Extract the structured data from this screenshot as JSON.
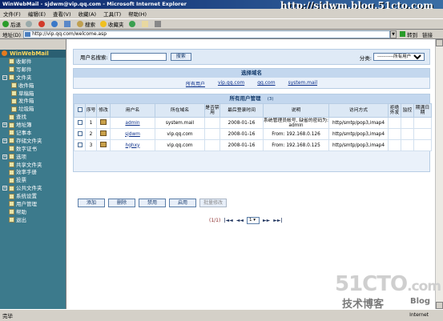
{
  "window": {
    "title": "WinWebMail - sjdwm@vip.qq.com - Microsoft Internet Explorer"
  },
  "watermark": "http://sjdwm.blog.51cto.com",
  "menu": [
    "文件(F)",
    "编辑(E)",
    "查看(V)",
    "收藏(A)",
    "工具(T)",
    "帮助(H)"
  ],
  "toolbar": {
    "back": "后退",
    "search": "搜索",
    "favorites": "收藏夹"
  },
  "address": {
    "label": "地址(D)",
    "url": "http://vip.qq.com/welcome.asp",
    "go": "转到",
    "links": "链接"
  },
  "sidebar": {
    "header": "WinWebMail",
    "items": [
      {
        "label": "收邮件",
        "level": "top"
      },
      {
        "label": "写邮件",
        "level": "top"
      },
      {
        "label": "文件夹",
        "level": "top",
        "expander": "−"
      },
      {
        "label": "收件箱",
        "level": "sub"
      },
      {
        "label": "草稿箱",
        "level": "sub"
      },
      {
        "label": "发件箱",
        "level": "sub"
      },
      {
        "label": "垃圾箱",
        "level": "sub"
      },
      {
        "label": "查找",
        "level": "top"
      },
      {
        "label": "地址簿",
        "level": "top",
        "expander": "+"
      },
      {
        "label": "记事本",
        "level": "top"
      },
      {
        "label": "存储文件夹",
        "level": "top",
        "expander": "+"
      },
      {
        "label": "数字证书",
        "level": "top"
      },
      {
        "label": "选项",
        "level": "top",
        "expander": "+"
      },
      {
        "label": "共享文件夹",
        "level": "top"
      },
      {
        "label": "效率手册",
        "level": "top"
      },
      {
        "label": "投票",
        "level": "top"
      },
      {
        "label": "公共文件夹",
        "level": "top",
        "expander": "+"
      },
      {
        "label": "系统设置",
        "level": "top"
      },
      {
        "label": "用户管理",
        "level": "top"
      },
      {
        "label": "帮助",
        "level": "top"
      },
      {
        "label": "退出",
        "level": "top"
      }
    ]
  },
  "search": {
    "label": "用户名搜索:",
    "value": "",
    "button": "搜索",
    "category_label": "分类:",
    "category_value": "-----------所有用户-----------"
  },
  "domains": {
    "title": "选择域名",
    "items": [
      "所有用户",
      "vip.qq.com",
      "qq.com",
      "system.mail"
    ]
  },
  "users": {
    "title": "所有用户管理",
    "count": "(3)",
    "columns": [
      "",
      "序号",
      "修改",
      "用户名",
      "所在域名",
      "是否禁用",
      "最后登录时间",
      "说明",
      "访问方式",
      "拒绝外发",
      "监控",
      "期满日期"
    ],
    "rows": [
      {
        "no": "1",
        "name": "admin",
        "domain": "system.mail",
        "disabled": "",
        "last_login": "2008-01-16",
        "desc": "系统管理员帐号, 缺省的密码为: admin",
        "access": "http/smtp/pop3,imap4"
      },
      {
        "no": "2",
        "name": "sjdwm",
        "domain": "vip.qq.com",
        "disabled": "",
        "last_login": "2008-01-16",
        "desc": "From: 192.168.0.126",
        "access": "http/smtp/pop3,imap4"
      },
      {
        "no": "3",
        "name": "hghxy",
        "domain": "vip.qq.com",
        "disabled": "",
        "last_login": "2008-01-16",
        "desc": "From: 192.168.0.125",
        "access": "http/smtp/pop3,imap4"
      }
    ]
  },
  "actions": {
    "add": "添加",
    "delete": "删除",
    "disable": "禁用",
    "enable": "启用",
    "batch": "批量修改"
  },
  "pager": {
    "info": "(1/1)",
    "first": "|◄◄",
    "prev": "◄◄",
    "page": "1",
    "next": "►►",
    "last": "►►|"
  },
  "status": {
    "text": "完毕",
    "zone": "Internet"
  },
  "brand": {
    "main": "51CTO",
    "dot_com": ".com",
    "sub": "技术博客",
    "blog": "Blog"
  }
}
